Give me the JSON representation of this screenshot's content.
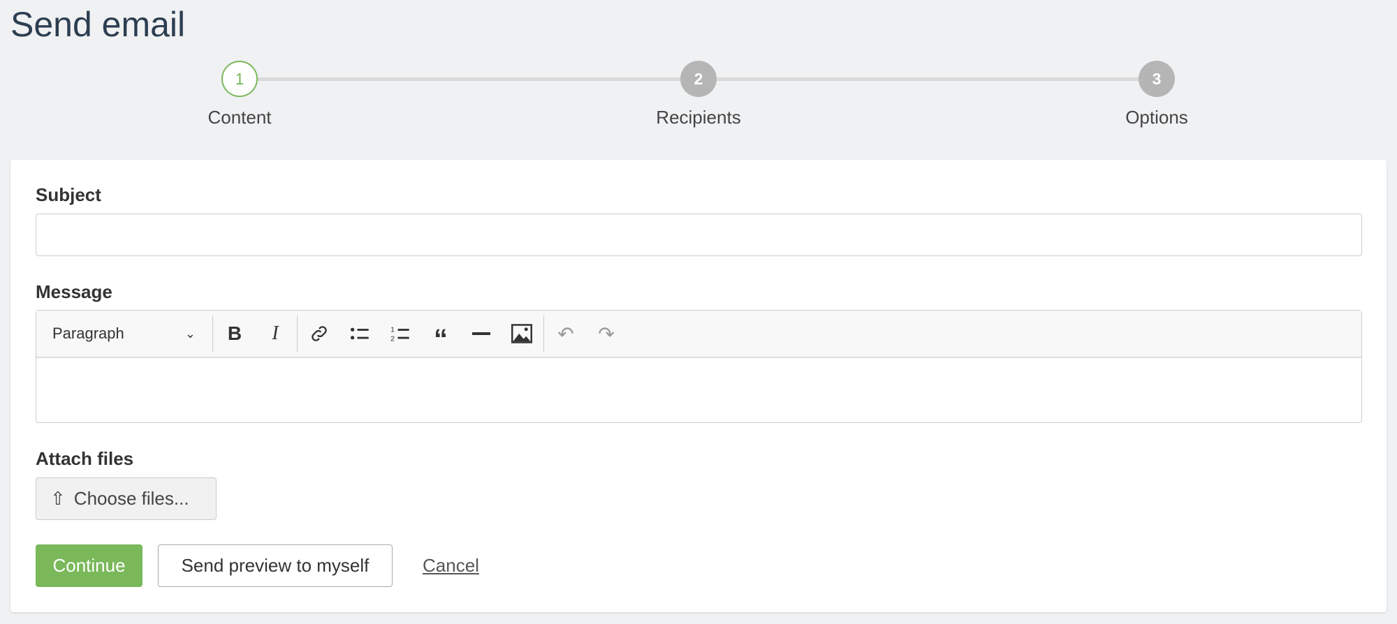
{
  "page": {
    "title": "Send email"
  },
  "steps": [
    {
      "number": "1",
      "label": "Content",
      "state": "active"
    },
    {
      "number": "2",
      "label": "Recipients",
      "state": "pending"
    },
    {
      "number": "3",
      "label": "Options",
      "state": "pending"
    }
  ],
  "form": {
    "subject_label": "Subject",
    "subject_value": "",
    "message_label": "Message",
    "toolbar": {
      "format": "Paragraph",
      "icons": [
        "bold-icon",
        "italic-icon",
        "link-icon",
        "bulleted-list-icon",
        "numbered-list-icon",
        "blockquote-icon",
        "horizontal-line-icon",
        "image-icon",
        "undo-icon",
        "redo-icon"
      ]
    },
    "attach_label": "Attach files",
    "choose_files": "Choose files...",
    "continue": "Continue",
    "preview": "Send preview to myself",
    "cancel": "Cancel"
  },
  "colors": {
    "accent": "#7ab85a",
    "pending": "#b5b5b5"
  }
}
